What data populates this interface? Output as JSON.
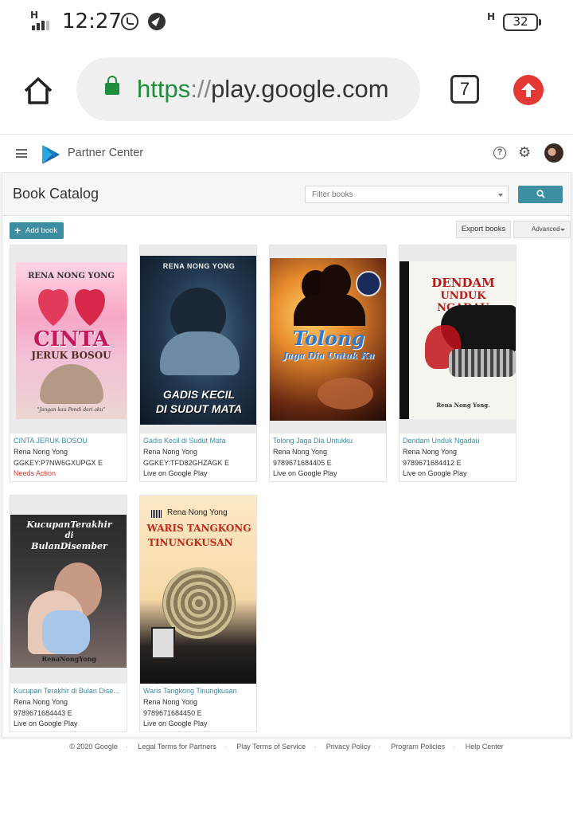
{
  "status_bar": {
    "network_left": "H",
    "time": "12:27",
    "network_right": "H",
    "battery": "32"
  },
  "browser": {
    "url_scheme": "https",
    "url_sep": "://",
    "url_host": "play.google.com",
    "tab_count": "7"
  },
  "header": {
    "title": "Partner Center"
  },
  "catalog": {
    "title": "Book Catalog",
    "filter_placeholder": "Filter books",
    "add_book_label": "Add book",
    "export_label": "Export books",
    "advanced_label": "Advanced"
  },
  "books": [
    {
      "title": "CINTA JERUK BOSOU",
      "author": "Rena Nong Yong",
      "id": "GGKEY:P7NW6GXUPGX E",
      "status": "Needs Action",
      "cover": {
        "author_line": "RENA NONG YONG",
        "title_top": "CINTA",
        "title_bottom": "JERUK BOSOU",
        "tagline": "\"Jangan kau Pendi dari aku\""
      }
    },
    {
      "title": "Gadis Kecil di Sudut Mata",
      "author": "Rena Nong Yong",
      "id": "GGKEY:TFD82GHZAGK E",
      "status": "Live on Google Play",
      "cover": {
        "author_line": "RENA NONG YONG",
        "title_top": "GADIS KECIL",
        "title_bottom": "DI SUDUT MATA"
      }
    },
    {
      "title": "Tolong Jaga Dia Untukku",
      "author": "Rena Nong Yong",
      "id": "9789671684405 E",
      "status": "Live on Google Play",
      "cover": {
        "title_top": "Tolong",
        "title_bottom": "Jaga Dia Untuk Ku"
      }
    },
    {
      "title": "Dendam Unduk Ngadau",
      "author": "Rena Nong Yong",
      "id": "9789671684412 E",
      "status": "Live on Google Play",
      "cover": {
        "title_top": "DENDAM",
        "title_bottom": "UNDUK NGADAU",
        "author_line": "Rena Nong Yong."
      }
    },
    {
      "title": "Kucupan Terakhir di Bulan Dise...",
      "author": "Rena Nong Yong",
      "id": "9789671684443 E",
      "status": "Live on Google Play",
      "cover": {
        "title_top": "KucupanTerakhir",
        "title_mid": "di",
        "title_bottom": "BulanDisember",
        "author_line": "RenaNongYong"
      }
    },
    {
      "title": "Waris Tangkong Tinungkusan",
      "author": "Rena Nong Yong",
      "id": "9789671684450 E",
      "status": "Live on Google Play",
      "cover": {
        "author_line": "Rena Nong Yong",
        "title_top": "WARIS TANGKONG",
        "title_bottom": "TINUNGKUSAN"
      }
    }
  ],
  "footer": {
    "links": [
      "© 2020 Google",
      "Legal Terms for Partners",
      "Play Terms of Service",
      "Privacy Policy",
      "Program Policies",
      "Help Center"
    ]
  },
  "colors": {
    "accent": "#3d8ea3",
    "warning": "#d23f31",
    "secure": "#1e8e3e"
  }
}
